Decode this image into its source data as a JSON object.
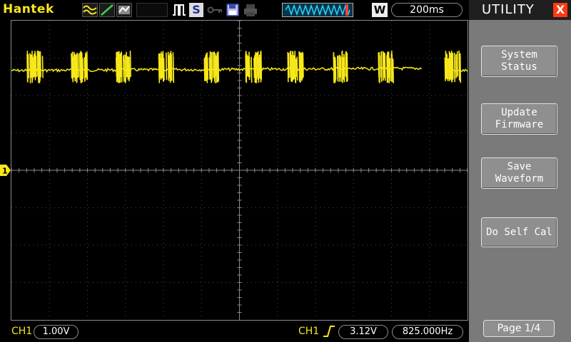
{
  "topbar": {
    "brand": "Hantek",
    "timebase": "200ms",
    "window_label": "W",
    "single_label": "S",
    "icons": [
      "wave-mode-icon",
      "line-mode-icon",
      "persistence-mode-icon",
      "pulse-trigger-icon",
      "single-shot-icon",
      "key-lock-icon",
      "save-disk-icon",
      "printer-icon",
      "memory-waveform-icon",
      "window-icon"
    ]
  },
  "channel": {
    "label": "CH1",
    "scale": "1.00V",
    "color": "#f7e81a",
    "marker": "1"
  },
  "trigger": {
    "source": "CH1",
    "edge": "rising-edge-icon",
    "level": "3.12V",
    "frequency": "825.000Hz"
  },
  "menu": {
    "title": "UTILITY",
    "close": "X",
    "buttons": [
      {
        "line1": "System",
        "line2": "Status"
      },
      {
        "line1": "Update",
        "line2": "Firmware"
      },
      {
        "line1": "Save",
        "line2": "Waveform"
      },
      {
        "line1": "Do Self Cal",
        "line2": ""
      }
    ],
    "page": "Page 1/4"
  },
  "colors": {
    "trace": "#f7e81a",
    "menu_bg": "#7a7a7a",
    "close": "#ff3a10"
  }
}
